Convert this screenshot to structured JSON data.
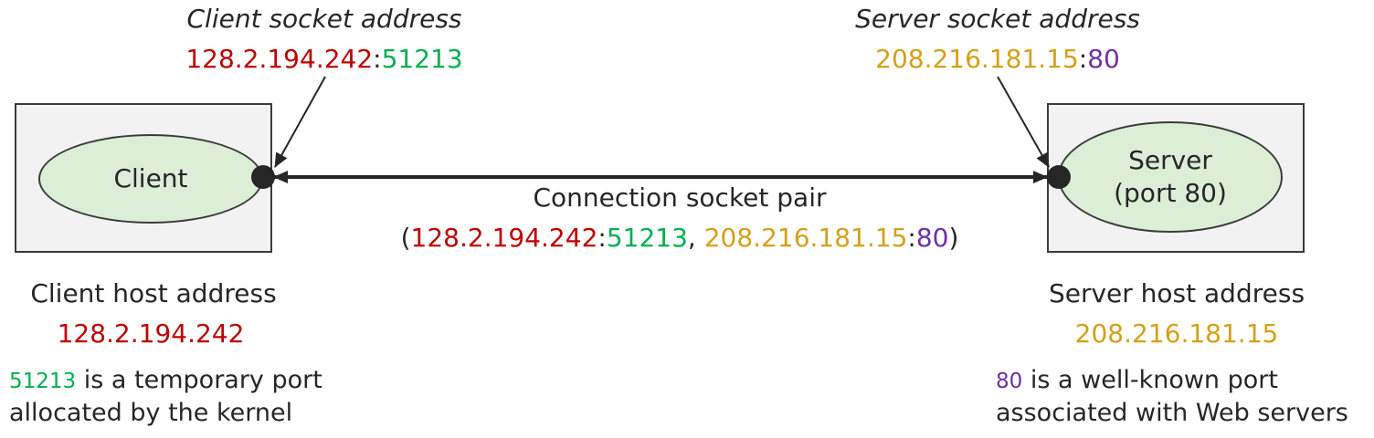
{
  "client": {
    "socket_title": "Client socket address",
    "ip": "128.2.194.242",
    "port": "51213",
    "label": "Client",
    "host_title": "Client host address",
    "port_note_rest": " is a temporary port",
    "port_note_line2": "allocated by the kernel"
  },
  "server": {
    "socket_title": "Server socket address",
    "ip": "208.216.181.15",
    "port": "80",
    "label_line1": "Server",
    "label_line2": "(port 80)",
    "host_title": "Server host address",
    "port_note_rest": " is a well-known port",
    "port_note_line2": "associated with Web servers"
  },
  "connection": {
    "title": "Connection socket pair",
    "open_paren": "(",
    "colon": ":",
    "comma": ", ",
    "close_paren": ")"
  },
  "colors": {
    "ip_client": "#c00000",
    "port_client": "#00b050",
    "ip_server": "#d4a017",
    "port_server": "#7030a0",
    "ellipse_fill": "#dcefd6",
    "host_fill": "#f2f2f2"
  }
}
